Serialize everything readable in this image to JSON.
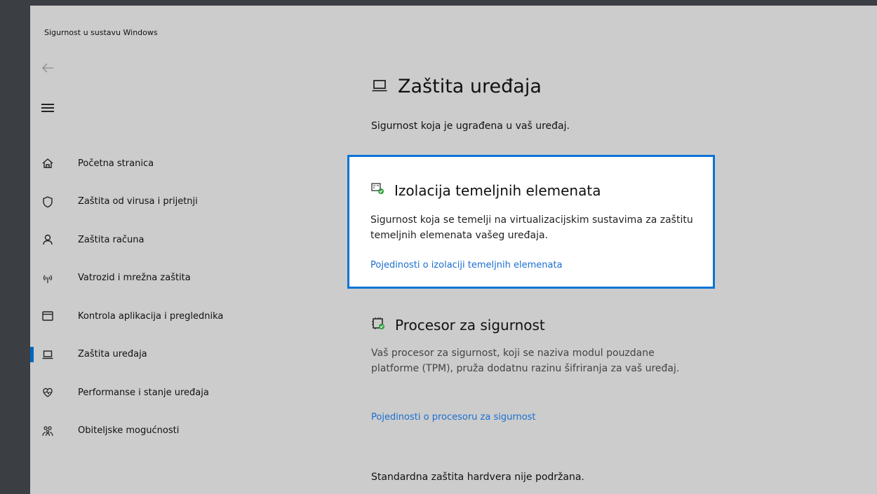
{
  "window": {
    "title": "Sigurnost u sustavu Windows"
  },
  "nav": {
    "items": [
      {
        "label": "Početna stranica",
        "icon": "home-icon"
      },
      {
        "label": "Zaštita od virusa i prijetnji",
        "icon": "shield-icon"
      },
      {
        "label": "Zaštita računa",
        "icon": "person-icon"
      },
      {
        "label": "Vatrozid i mrežna zaštita",
        "icon": "wifi-signal-icon"
      },
      {
        "label": "Kontrola aplikacija i preglednika",
        "icon": "browser-window-icon"
      },
      {
        "label": "Zaštita uređaja",
        "icon": "laptop-icon",
        "active": true
      },
      {
        "label": "Performanse i stanje uređaja",
        "icon": "heart-pulse-icon"
      },
      {
        "label": "Obiteljske mogućnosti",
        "icon": "family-icon"
      }
    ]
  },
  "main": {
    "title": "Zaštita uređaja",
    "subtitle": "Sigurnost koja je ugrađena u vaš uređaj.",
    "core_isolation": {
      "heading": "Izolacija temeljnih elemenata",
      "description": "Sigurnost koja se temelji na virtualizacijskim sustavima za zaštitu temeljnih elemenata vašeg uređaja.",
      "link": "Pojedinosti o izolaciji temeljnih elemenata"
    },
    "security_processor": {
      "heading": "Procesor za sigurnost",
      "description": "Vaš procesor za sigurnost, koji se naziva modul pouzdane platforme (TPM), pruža dodatnu razinu šifriranja za vaš uređaj.",
      "link": "Pojedinosti o procesoru za sigurnost"
    },
    "standard_protection": "Standardna zaštita hardvera nije podržana."
  },
  "colors": {
    "accent": "#0067c0",
    "link": "#1a6fd0",
    "ok_green": "#2e9e3e"
  }
}
